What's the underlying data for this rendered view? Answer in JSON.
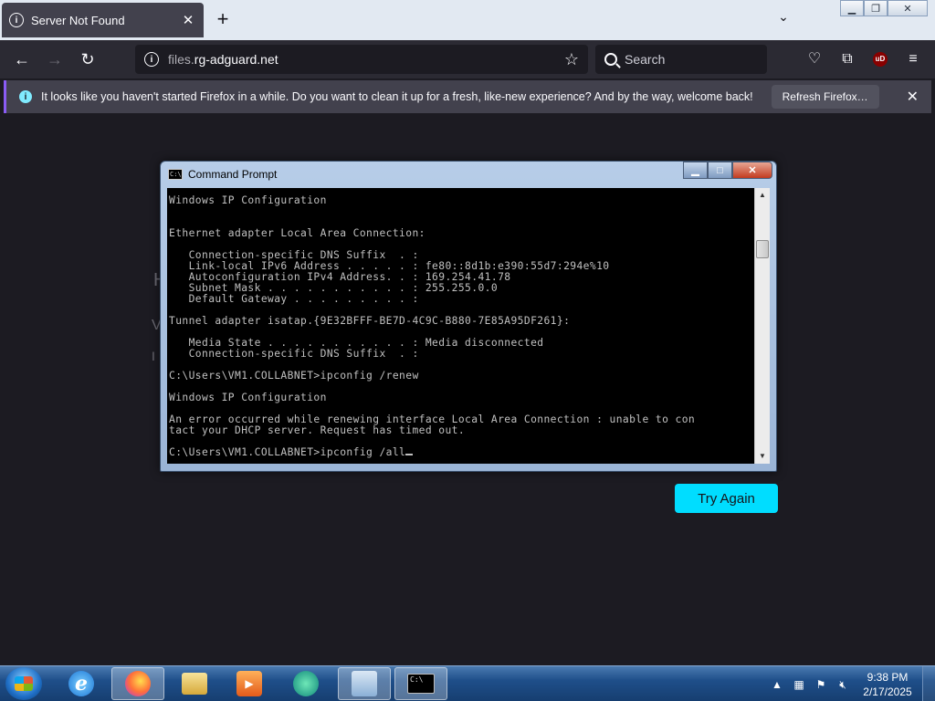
{
  "browser": {
    "tab": {
      "title": "Server Not Found",
      "icon": "info-icon"
    },
    "new_tab_symbol": "+",
    "url": {
      "dim": "files.",
      "main": "rg-adguard.net"
    },
    "search_placeholder": "Search",
    "notification": {
      "text": "It looks like you haven't started Firefox in a while. Do you want to clean it up for a fresh, like-new experience? And by the way, welcome back!",
      "button": "Refresh Firefox…"
    },
    "ublock_label": "uD"
  },
  "page": {
    "try_again": "Try Again"
  },
  "cmd": {
    "title": "Command Prompt",
    "icon_text": "C:\\",
    "lines": [
      "Windows IP Configuration",
      "",
      "",
      "Ethernet adapter Local Area Connection:",
      "",
      "   Connection-specific DNS Suffix  . :",
      "   Link-local IPv6 Address . . . . . : fe80::8d1b:e390:55d7:294e%10",
      "   Autoconfiguration IPv4 Address. . : 169.254.41.78",
      "   Subnet Mask . . . . . . . . . . . : 255.255.0.0",
      "   Default Gateway . . . . . . . . . :",
      "",
      "Tunnel adapter isatap.{9E32BFFF-BE7D-4C9C-B880-7E85A95DF261}:",
      "",
      "   Media State . . . . . . . . . . . : Media disconnected",
      "   Connection-specific DNS Suffix  . :",
      "",
      "C:\\Users\\VM1.COLLABNET>ipconfig /renew",
      "",
      "Windows IP Configuration",
      "",
      "An error occurred while renewing interface Local Area Connection : unable to con",
      "tact your DHCP server. Request has timed out.",
      ""
    ],
    "prompt": "C:\\Users\\VM1.COLLABNET>ipconfig /all"
  },
  "taskbar": {
    "clock_time": "9:38 PM",
    "clock_date": "2/17/2025"
  }
}
